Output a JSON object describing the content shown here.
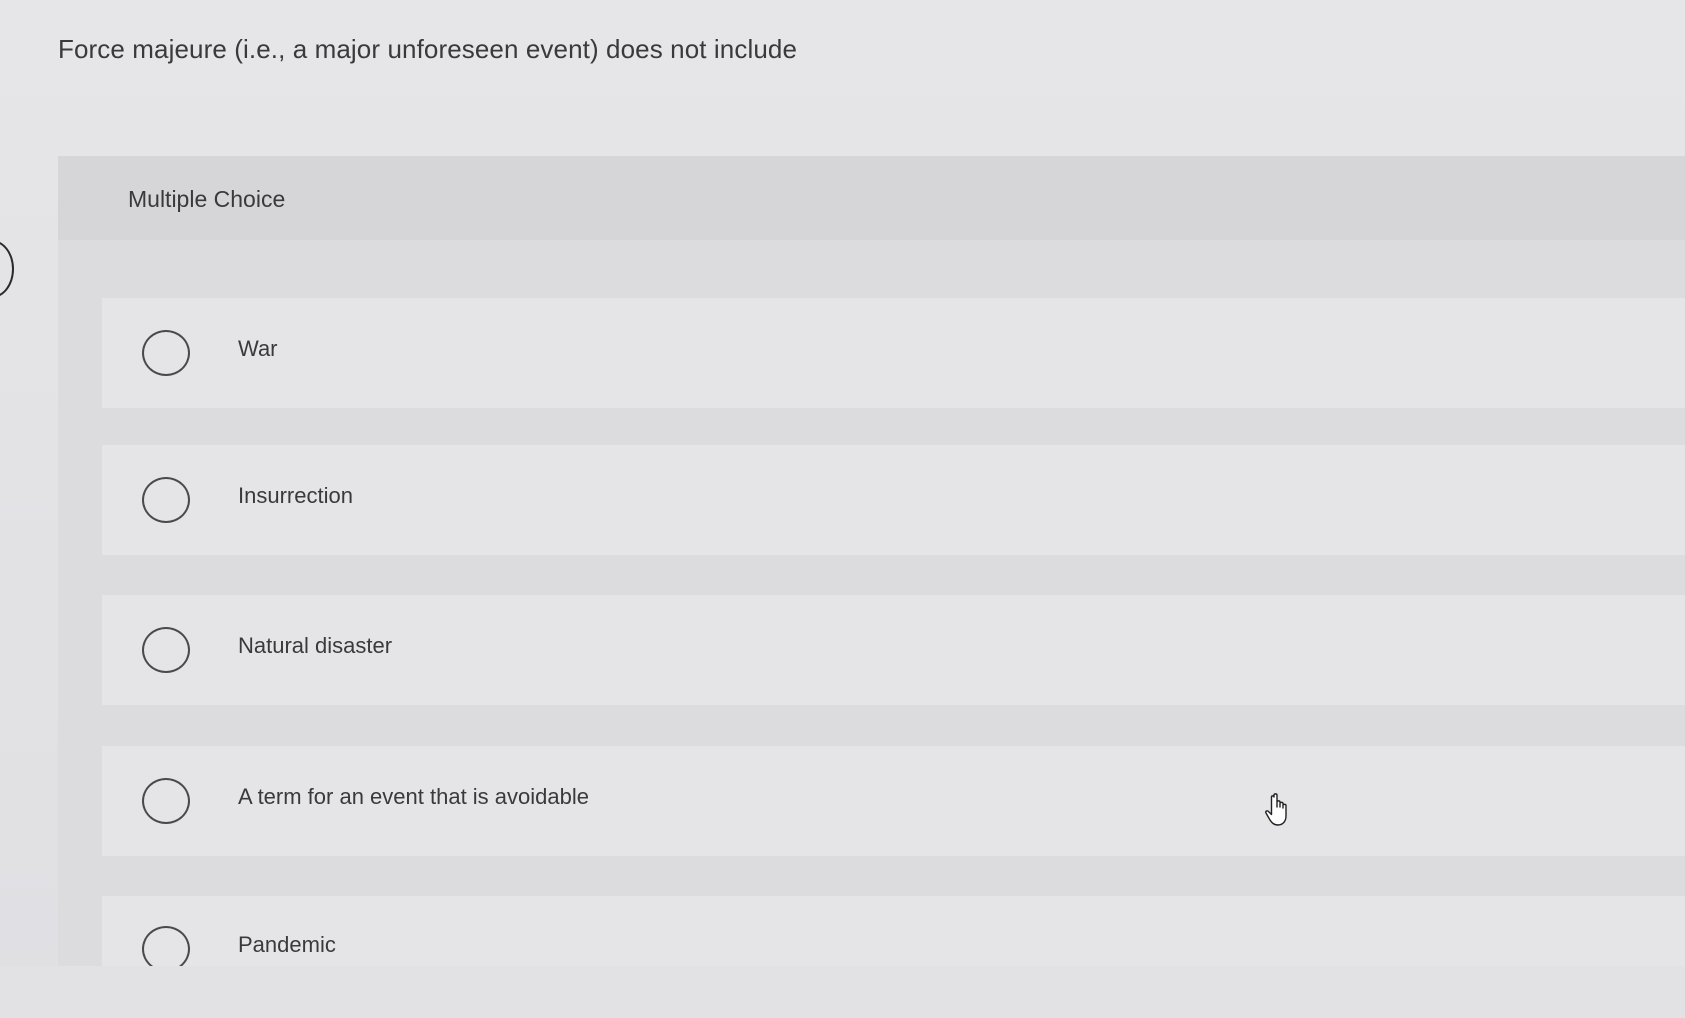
{
  "question": {
    "text": "Force majeure (i.e., a major unforeseen event) does not  include"
  },
  "multiple_choice": {
    "label": "Multiple Choice",
    "options": [
      {
        "label": "War",
        "selected": false
      },
      {
        "label": "Insurrection",
        "selected": false
      },
      {
        "label": "Natural disaster",
        "selected": false
      },
      {
        "label": "A term for an event that is avoidable",
        "selected": false
      },
      {
        "label": "Pandemic",
        "selected": false
      }
    ]
  },
  "icons": {
    "cursor": "hand-pointer-icon",
    "radio": "radio-button-icon"
  },
  "colors": {
    "background": "#e4e4e6",
    "panel": "#dcdcdf",
    "option_background": "#e5e5e8",
    "text": "#3a3a3c"
  }
}
